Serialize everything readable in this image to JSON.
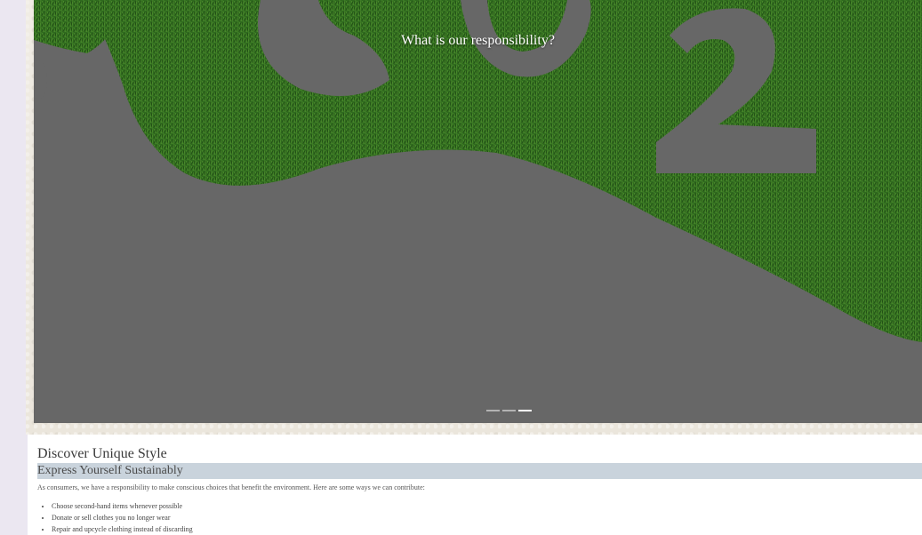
{
  "carousel": {
    "caption": "What is our responsibility?",
    "background_color": "#676767",
    "grass_color": "#2f6a1e",
    "slide_count": 3,
    "active_slide": 3
  },
  "section": {
    "title": "Discover Unique Style",
    "subtitle": "Express Yourself Sustainably",
    "intro": "As consumers, we have a responsibility to make conscious choices that benefit the environment. Here are some ways we can contribute:",
    "tips": [
      "Choose second-hand items whenever possible",
      "Donate or sell clothes you no longer wear",
      "Repair and upcycle clothing instead of discarding"
    ]
  }
}
